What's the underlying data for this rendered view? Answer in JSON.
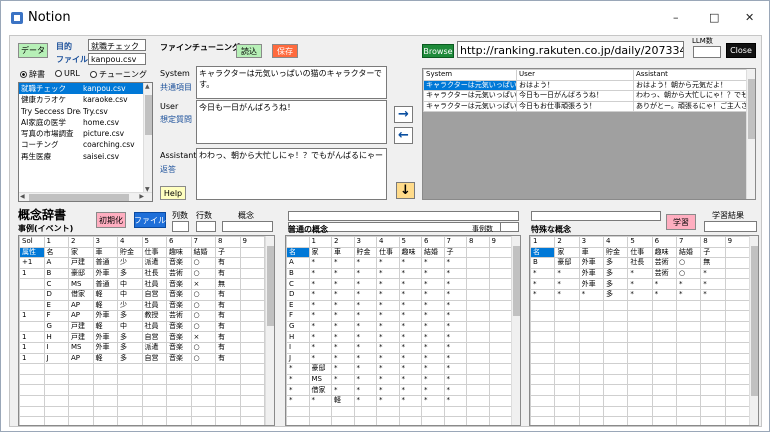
{
  "window": {
    "title": "Notion",
    "minimize": "–",
    "maximize": "□",
    "close": "✕"
  },
  "top": {
    "data_button": "データ",
    "purpose_label": "目的",
    "purpose_value": "就職チェック",
    "file_label": "ファイル",
    "file_value": "kanpou.csv",
    "finetuning_label": "ファインチューニング",
    "load_button": "読込",
    "save_button": "保存",
    "radios": [
      {
        "label": "辞書",
        "checked": true
      },
      {
        "label": "URL",
        "checked": false
      },
      {
        "label": "チューニング",
        "checked": false
      }
    ]
  },
  "files": [
    {
      "name": "就職チェック",
      "file": "kanpou.csv",
      "selected": true
    },
    {
      "name": "健康カラオケ",
      "file": "karaoke.csv",
      "selected": false
    },
    {
      "name": "Try Seccess Dream",
      "file": "Try.csv",
      "selected": false
    },
    {
      "name": "AI家庭の医学",
      "file": "home.csv",
      "selected": false
    },
    {
      "name": "写真の市場調査",
      "file": "picture.csv",
      "selected": false
    },
    {
      "name": "コーチング",
      "file": "coarching.csv",
      "selected": false
    },
    {
      "name": "再生医療",
      "file": "saisei.csv",
      "selected": false
    }
  ],
  "prompts": {
    "system_label": "System",
    "system_sub": "共通項目",
    "system_text": "キャラクターは元気いっぱいの猫のキャラクターです。",
    "user_label": "User",
    "user_sub": "想定質問",
    "user_text": "今日も一日がんばろうね！",
    "assistant_label": "Assistant",
    "assistant_sub": "返答",
    "assistant_text": "わわっ、朝から大忙しにゃ！？でもがんばるにゃー",
    "help_button": "Help"
  },
  "arrows": {
    "right": "→",
    "left": "←",
    "down": "↓"
  },
  "url": {
    "browse_button": "Browse",
    "url_value": "http://ranking.rakuten.co.jp/daily/207334/",
    "llm_label": "LLM数",
    "close_button": "Close"
  },
  "dialog": {
    "headers": [
      "System",
      "User",
      "Assistant"
    ],
    "rows": [
      [
        "キャラクターは元気いっぱいの...",
        "おはよう！",
        "おはよう！朝から元気だよ！"
      ],
      [
        "キャラクターは元気いっぱいの...",
        "今日も一日がんばろうね！",
        "わわっ、朝から大忙しにゃ！？でもがん..."
      ],
      [
        "キャラクターは元気いっぱいの...",
        "今日もお仕事頑張ろう！",
        "ありがとー。頑張るにゃ！ご主人さまと..."
      ]
    ]
  },
  "dict": {
    "title": "概念辞書",
    "init_button": "初期化",
    "file_button": "ファイル",
    "col_count_label": "列数",
    "row_count_label": "行数",
    "concept_label": "概念",
    "event_label": "事例(イベント)",
    "common_label": "普通の概念",
    "instance_count_label": "事例数",
    "special_label": "特殊な概念",
    "learn_button": "学習",
    "result_label": "学習結果"
  },
  "grid1": {
    "header": [
      "Sol",
      "1",
      "2",
      "3",
      "4",
      "5",
      "6",
      "7",
      "8",
      "9"
    ],
    "rows": [
      [
        "属性",
        "名",
        "家",
        "車",
        "貯金",
        "仕事",
        "趣味",
        "結婚",
        "子",
        ""
      ],
      [
        "+1",
        "A",
        "戸建",
        "普通",
        "少",
        "派遣",
        "音楽",
        "○",
        "有",
        ""
      ],
      [
        "1",
        "B",
        "豪邸",
        "外車",
        "多",
        "社長",
        "芸術",
        "○",
        "有",
        ""
      ],
      [
        "",
        "C",
        "MS",
        "普通",
        "中",
        "社員",
        "音楽",
        "×",
        "無",
        ""
      ],
      [
        "",
        "D",
        "借家",
        "軽",
        "中",
        "自営",
        "音楽",
        "○",
        "有",
        ""
      ],
      [
        "",
        "E",
        "AP",
        "軽",
        "少",
        "社員",
        "音楽",
        "○",
        "有",
        ""
      ],
      [
        "1",
        "F",
        "AP",
        "外車",
        "多",
        "教授",
        "芸術",
        "○",
        "有",
        ""
      ],
      [
        "",
        "G",
        "戸建",
        "軽",
        "中",
        "社員",
        "音楽",
        "○",
        "有",
        ""
      ],
      [
        "1",
        "H",
        "戸建",
        "外車",
        "多",
        "自営",
        "音楽",
        "×",
        "有",
        ""
      ],
      [
        "1",
        "I",
        "MS",
        "外車",
        "多",
        "派遣",
        "音楽",
        "○",
        "有",
        ""
      ],
      [
        "1",
        "J",
        "AP",
        "軽",
        "多",
        "自営",
        "音楽",
        "○",
        "有",
        ""
      ],
      [
        "",
        "",
        "",
        "",
        "",
        "",
        "",
        "",
        "",
        ""
      ],
      [
        "",
        "",
        "",
        "",
        "",
        "",
        "",
        "",
        "",
        ""
      ],
      [
        "",
        "",
        "",
        "",
        "",
        "",
        "",
        "",
        "",
        ""
      ],
      [
        "",
        "",
        "",
        "",
        "",
        "",
        "",
        "",
        "",
        ""
      ],
      [
        "",
        "",
        "",
        "",
        "",
        "",
        "",
        "",
        "",
        ""
      ],
      [
        "",
        "",
        "",
        "",
        "",
        "",
        "",
        "",
        "",
        ""
      ]
    ]
  },
  "grid2": {
    "header": [
      "",
      "1",
      "2",
      "3",
      "4",
      "5",
      "6",
      "7",
      "8",
      "9"
    ],
    "rows": [
      [
        "名",
        "家",
        "車",
        "貯金",
        "仕事",
        "趣味",
        "結婚",
        "子",
        "",
        ""
      ],
      [
        "A",
        "*",
        "*",
        "*",
        "*",
        "*",
        "*",
        "*",
        "",
        ""
      ],
      [
        "B",
        "*",
        "*",
        "*",
        "*",
        "*",
        "*",
        "*",
        "",
        ""
      ],
      [
        "C",
        "*",
        "*",
        "*",
        "*",
        "*",
        "*",
        "*",
        "",
        ""
      ],
      [
        "D",
        "*",
        "*",
        "*",
        "*",
        "*",
        "*",
        "*",
        "",
        ""
      ],
      [
        "E",
        "*",
        "*",
        "*",
        "*",
        "*",
        "*",
        "*",
        "",
        ""
      ],
      [
        "F",
        "*",
        "*",
        "*",
        "*",
        "*",
        "*",
        "*",
        "",
        ""
      ],
      [
        "G",
        "*",
        "*",
        "*",
        "*",
        "*",
        "*",
        "*",
        "",
        ""
      ],
      [
        "H",
        "*",
        "*",
        "*",
        "*",
        "*",
        "*",
        "*",
        "",
        ""
      ],
      [
        "I",
        "*",
        "*",
        "*",
        "*",
        "*",
        "*",
        "*",
        "",
        ""
      ],
      [
        "J",
        "*",
        "*",
        "*",
        "*",
        "*",
        "*",
        "*",
        "",
        ""
      ],
      [
        "*",
        "豪邸",
        "*",
        "*",
        "*",
        "*",
        "*",
        "*",
        "",
        ""
      ],
      [
        "*",
        "MS",
        "*",
        "*",
        "*",
        "*",
        "*",
        "*",
        "",
        ""
      ],
      [
        "*",
        "借家",
        "*",
        "*",
        "*",
        "*",
        "*",
        "*",
        "",
        ""
      ],
      [
        "*",
        "*",
        "軽",
        "*",
        "*",
        "*",
        "*",
        "*",
        "",
        ""
      ],
      [
        "",
        "",
        "",
        "",
        "",
        "",
        "",
        "",
        "",
        ""
      ],
      [
        "",
        "",
        "",
        "",
        "",
        "",
        "",
        "",
        "",
        ""
      ]
    ]
  },
  "grid3": {
    "header": [
      "1",
      "2",
      "3",
      "4",
      "5",
      "6",
      "7",
      "8",
      "9"
    ],
    "rows": [
      [
        "名",
        "家",
        "車",
        "貯金",
        "仕事",
        "趣味",
        "結婚",
        "子",
        ""
      ],
      [
        "B",
        "豪邸",
        "外車",
        "多",
        "社長",
        "芸術",
        "○",
        "無",
        ""
      ],
      [
        "*",
        "*",
        "外車",
        "多",
        "*",
        "芸術",
        "○",
        "*",
        ""
      ],
      [
        "*",
        "*",
        "外車",
        "多",
        "*",
        "*",
        "*",
        "*",
        ""
      ],
      [
        "*",
        "*",
        "*",
        "多",
        "*",
        "*",
        "*",
        "*",
        ""
      ],
      [
        "",
        "",
        "",
        "",
        "",
        "",
        "",
        "",
        ""
      ],
      [
        "",
        "",
        "",
        "",
        "",
        "",
        "",
        "",
        ""
      ],
      [
        "",
        "",
        "",
        "",
        "",
        "",
        "",
        "",
        ""
      ],
      [
        "",
        "",
        "",
        "",
        "",
        "",
        "",
        "",
        ""
      ],
      [
        "",
        "",
        "",
        "",
        "",
        "",
        "",
        "",
        ""
      ],
      [
        "",
        "",
        "",
        "",
        "",
        "",
        "",
        "",
        ""
      ],
      [
        "",
        "",
        "",
        "",
        "",
        "",
        "",
        "",
        ""
      ],
      [
        "",
        "",
        "",
        "",
        "",
        "",
        "",
        "",
        ""
      ],
      [
        "",
        "",
        "",
        "",
        "",
        "",
        "",
        "",
        ""
      ],
      [
        "",
        "",
        "",
        "",
        "",
        "",
        "",
        "",
        ""
      ],
      [
        "",
        "",
        "",
        "",
        "",
        "",
        "",
        "",
        ""
      ],
      [
        "",
        "",
        "",
        "",
        "",
        "",
        "",
        "",
        ""
      ]
    ]
  },
  "colors": {
    "green_btn": "#b7f0b7",
    "orange_btn": "#ff6a3d",
    "pink_btn": "#ffaec0",
    "yellow_btn": "#ffffc0",
    "selection": "#0078d7",
    "label_blue": "#1a4f9a"
  }
}
